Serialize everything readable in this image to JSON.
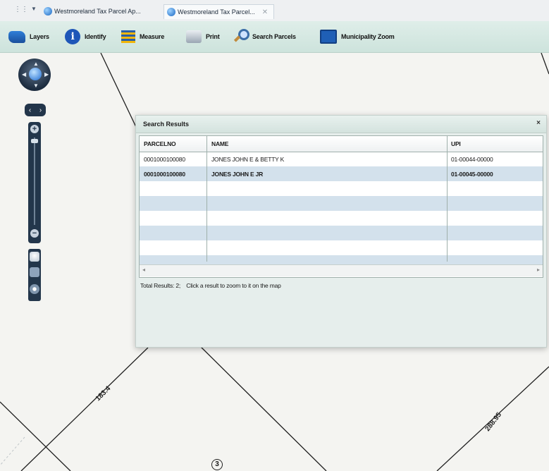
{
  "browser": {
    "tabs": [
      {
        "label": "Westmoreland Tax Parcel Ap..."
      },
      {
        "label": "Westmoreland Tax Parcel..."
      }
    ]
  },
  "toolbar": {
    "layers_label": "Layers",
    "identify_label": "Identify",
    "measure_label": "Measure",
    "print_label": "Print",
    "search_label": "Search Parcels",
    "muni_label": "Municipality Zoom"
  },
  "panel": {
    "title": "Search Results",
    "close": "×",
    "columns": [
      "PARCELNO",
      "NAME",
      "UPI"
    ],
    "rows": [
      {
        "parcelno": "0001000100080",
        "name": "JONES JOHN E & BETTY K",
        "upi": "01-00044-00000"
      },
      {
        "parcelno": "0001000100080",
        "name": "JONES JOHN E JR",
        "upi": "01-00045-00000"
      }
    ],
    "total_text": "Total Results: 2;",
    "hint_text": "Click a result to zoom to it on the map"
  },
  "map": {
    "labels": {
      "dim1": "183.4",
      "dim2": "288.95",
      "parcel_marker": "3"
    }
  }
}
